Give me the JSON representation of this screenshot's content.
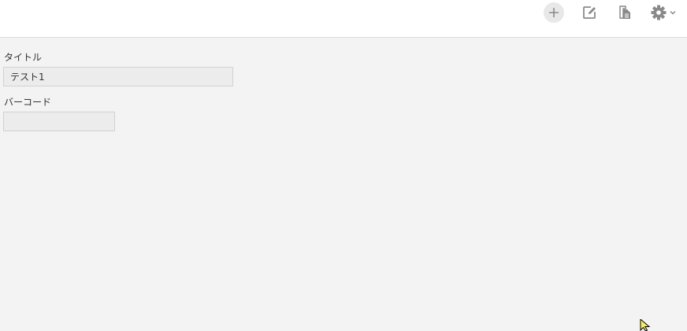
{
  "toolbar": {
    "add_icon": "plus-icon",
    "edit_icon": "edit-icon",
    "copy_icon": "copy-document-icon",
    "settings_icon": "gear-icon"
  },
  "form": {
    "title_label": "タイトル",
    "title_value": "テスト1",
    "barcode_label": "バーコード",
    "barcode_value": ""
  },
  "colors": {
    "background": "#f3f3f3",
    "toolbar_bg": "#ffffff",
    "icon": "#8a8a8a",
    "cursor": "#f5ec6a"
  }
}
